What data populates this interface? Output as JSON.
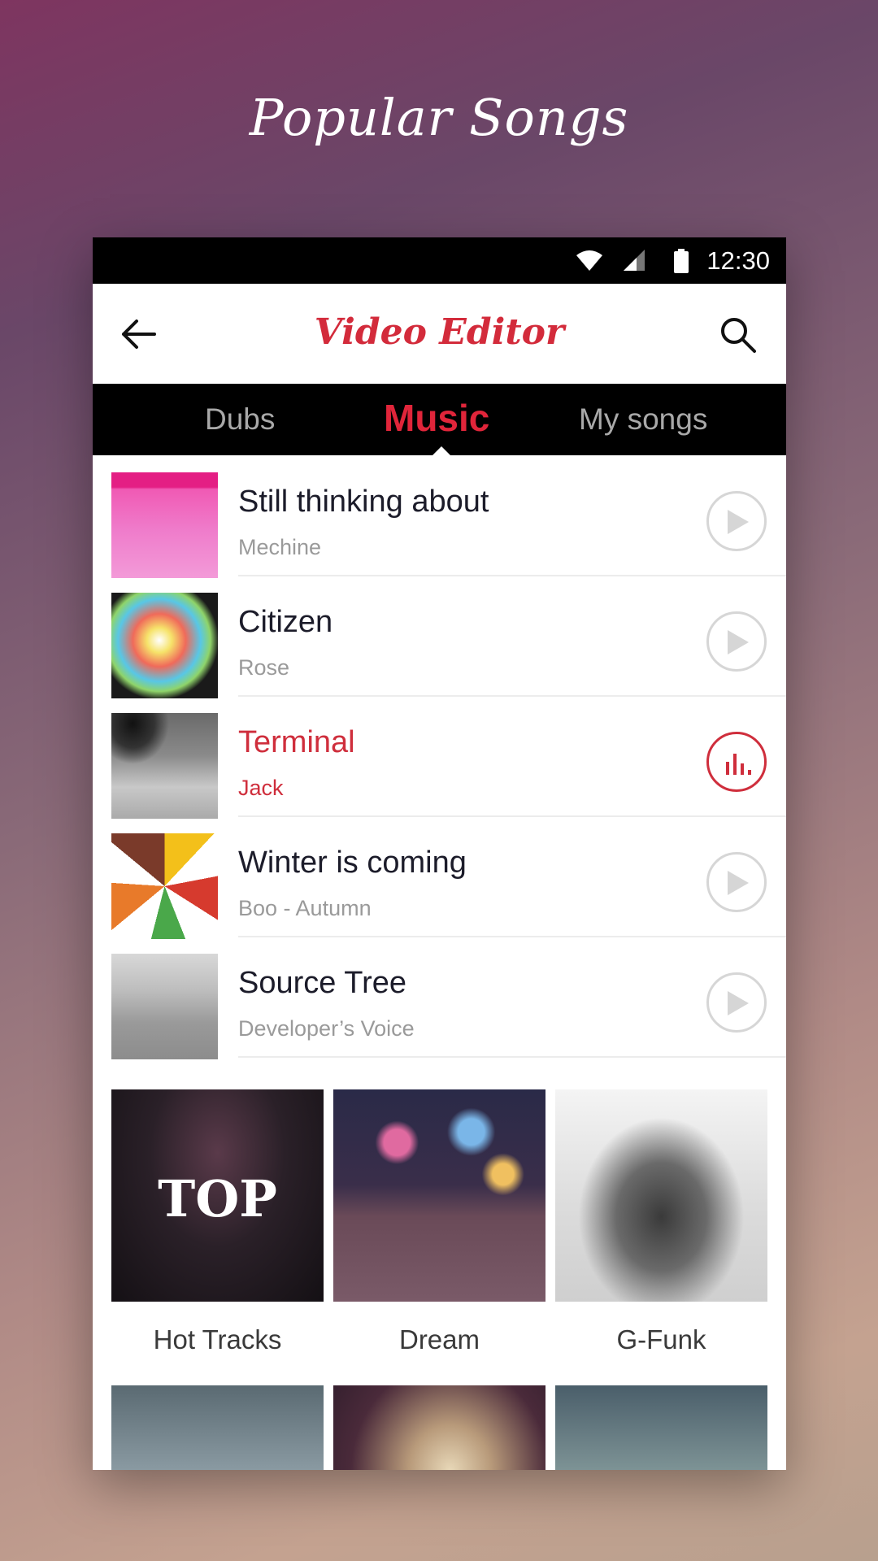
{
  "promo": {
    "title": "Popular Songs"
  },
  "status_bar": {
    "time": "12:30"
  },
  "app_bar": {
    "title": "Video Editor",
    "back_icon": "arrow-left-icon",
    "search_icon": "search-icon"
  },
  "tabs": [
    {
      "label": "Dubs",
      "active": false
    },
    {
      "label": "Music",
      "active": true
    },
    {
      "label": "My songs",
      "active": false
    }
  ],
  "songs": [
    {
      "title": "Still thinking about",
      "artist": "Mechine",
      "state": "idle",
      "icon": "play-icon"
    },
    {
      "title": "Citizen",
      "artist": "Rose",
      "state": "idle",
      "icon": "play-icon"
    },
    {
      "title": "Terminal",
      "artist": "Jack",
      "state": "playing",
      "icon": "equalizer-icon"
    },
    {
      "title": "Winter is coming",
      "artist": "Boo - Autumn",
      "state": "idle",
      "icon": "play-icon"
    },
    {
      "title": "Source Tree",
      "artist": "Developer’s Voice",
      "state": "idle",
      "icon": "play-icon"
    }
  ],
  "categories": [
    {
      "label": "Hot Tracks",
      "overlay_text": "TOP"
    },
    {
      "label": "Dream"
    },
    {
      "label": "G-Funk"
    }
  ],
  "colors": {
    "accent": "#d32b3b",
    "tab_inactive": "#a9a9a9",
    "bar": "#000000"
  }
}
